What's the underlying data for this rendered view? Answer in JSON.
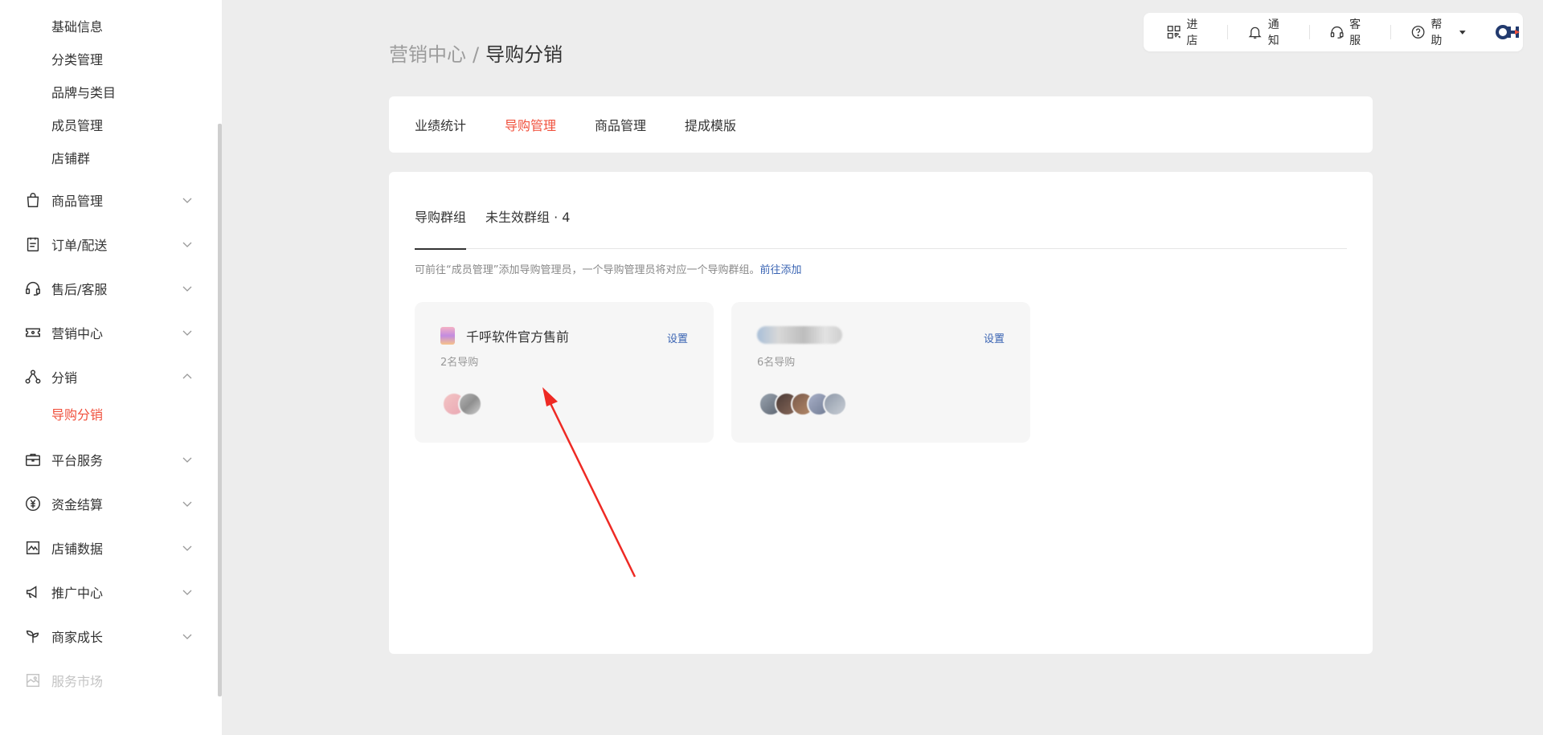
{
  "sidebar": {
    "sub_items_top": [
      "基础信息",
      "分类管理",
      "品牌与类目",
      "成员管理",
      "店铺群"
    ],
    "nav": [
      {
        "label": "商品管理",
        "icon": "shopping-bag-icon",
        "expanded": false
      },
      {
        "label": "订单/配送",
        "icon": "clipboard-icon",
        "expanded": false
      },
      {
        "label": "售后/客服",
        "icon": "headset-icon",
        "expanded": false
      },
      {
        "label": "营销中心",
        "icon": "ticket-icon",
        "expanded": false
      },
      {
        "label": "分销",
        "icon": "share-nodes-icon",
        "expanded": true
      },
      {
        "label": "平台服务",
        "icon": "briefcase-icon",
        "expanded": false
      },
      {
        "label": "资金结算",
        "icon": "yen-circle-icon",
        "expanded": false
      },
      {
        "label": "店铺数据",
        "icon": "chart-line-icon",
        "expanded": false
      },
      {
        "label": "推广中心",
        "icon": "megaphone-icon",
        "expanded": false
      },
      {
        "label": "商家成长",
        "icon": "sprout-icon",
        "expanded": false
      },
      {
        "label": "服务市场",
        "icon": "image-grid-icon",
        "expanded": false,
        "disabled": true
      }
    ],
    "distribution_sub": "导购分销"
  },
  "topbar": {
    "items": [
      "进店",
      "通知",
      "客服",
      "帮助"
    ]
  },
  "breadcrumb": {
    "parent": "营销中心",
    "separator": "/",
    "current": "导购分销"
  },
  "tabs": {
    "items": [
      "业绩统计",
      "导购管理",
      "商品管理",
      "提成模版"
    ],
    "active": "导购管理"
  },
  "subtabs": {
    "group": "导购群组",
    "inactive": "未生效群组 · 4"
  },
  "hint": {
    "text": "可前往“成员管理”添加导购管理员，一个导购管理员将对应一个导购群组。",
    "link": "前往添加"
  },
  "groups": [
    {
      "name": "千呼软件官方售前",
      "count": "2名导购",
      "settings": "设置"
    },
    {
      "name": "",
      "count": "6名导购",
      "settings": "设置"
    }
  ],
  "colors": {
    "accent": "#f0513d",
    "link": "#3a64b3",
    "annotation_arrow": "#ee2a24"
  }
}
